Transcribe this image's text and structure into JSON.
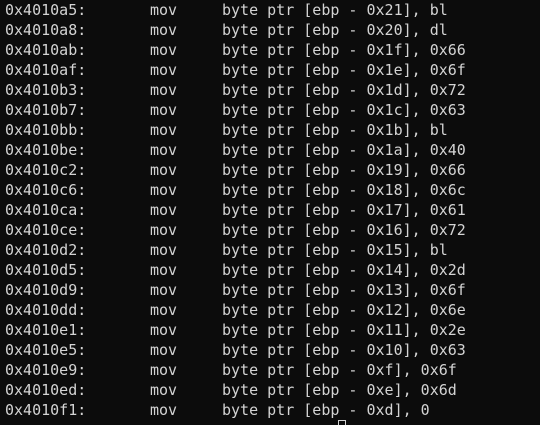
{
  "disassembly": [
    {
      "address": "0x4010a5:",
      "mnemonic": "mov",
      "operands": "byte ptr [ebp - 0x21], bl"
    },
    {
      "address": "0x4010a8:",
      "mnemonic": "mov",
      "operands": "byte ptr [ebp - 0x20], dl"
    },
    {
      "address": "0x4010ab:",
      "mnemonic": "mov",
      "operands": "byte ptr [ebp - 0x1f], 0x66"
    },
    {
      "address": "0x4010af:",
      "mnemonic": "mov",
      "operands": "byte ptr [ebp - 0x1e], 0x6f"
    },
    {
      "address": "0x4010b3:",
      "mnemonic": "mov",
      "operands": "byte ptr [ebp - 0x1d], 0x72"
    },
    {
      "address": "0x4010b7:",
      "mnemonic": "mov",
      "operands": "byte ptr [ebp - 0x1c], 0x63"
    },
    {
      "address": "0x4010bb:",
      "mnemonic": "mov",
      "operands": "byte ptr [ebp - 0x1b], bl"
    },
    {
      "address": "0x4010be:",
      "mnemonic": "mov",
      "operands": "byte ptr [ebp - 0x1a], 0x40"
    },
    {
      "address": "0x4010c2:",
      "mnemonic": "mov",
      "operands": "byte ptr [ebp - 0x19], 0x66"
    },
    {
      "address": "0x4010c6:",
      "mnemonic": "mov",
      "operands": "byte ptr [ebp - 0x18], 0x6c"
    },
    {
      "address": "0x4010ca:",
      "mnemonic": "mov",
      "operands": "byte ptr [ebp - 0x17], 0x61"
    },
    {
      "address": "0x4010ce:",
      "mnemonic": "mov",
      "operands": "byte ptr [ebp - 0x16], 0x72"
    },
    {
      "address": "0x4010d2:",
      "mnemonic": "mov",
      "operands": "byte ptr [ebp - 0x15], bl"
    },
    {
      "address": "0x4010d5:",
      "mnemonic": "mov",
      "operands": "byte ptr [ebp - 0x14], 0x2d"
    },
    {
      "address": "0x4010d9:",
      "mnemonic": "mov",
      "operands": "byte ptr [ebp - 0x13], 0x6f"
    },
    {
      "address": "0x4010dd:",
      "mnemonic": "mov",
      "operands": "byte ptr [ebp - 0x12], 0x6e"
    },
    {
      "address": "0x4010e1:",
      "mnemonic": "mov",
      "operands": "byte ptr [ebp - 0x11], 0x2e"
    },
    {
      "address": "0x4010e5:",
      "mnemonic": "mov",
      "operands": "byte ptr [ebp - 0x10], 0x63"
    },
    {
      "address": "0x4010e9:",
      "mnemonic": "mov",
      "operands": "byte ptr [ebp - 0xf], 0x6f"
    },
    {
      "address": "0x4010ed:",
      "mnemonic": "mov",
      "operands": "byte ptr [ebp - 0xe], 0x6d"
    },
    {
      "address": "0x4010f1:",
      "mnemonic": "mov",
      "operands": "byte ptr [ebp - 0xd], 0"
    }
  ],
  "colors": {
    "background": "#0c0c0c",
    "foreground": "#d4d4d4"
  }
}
